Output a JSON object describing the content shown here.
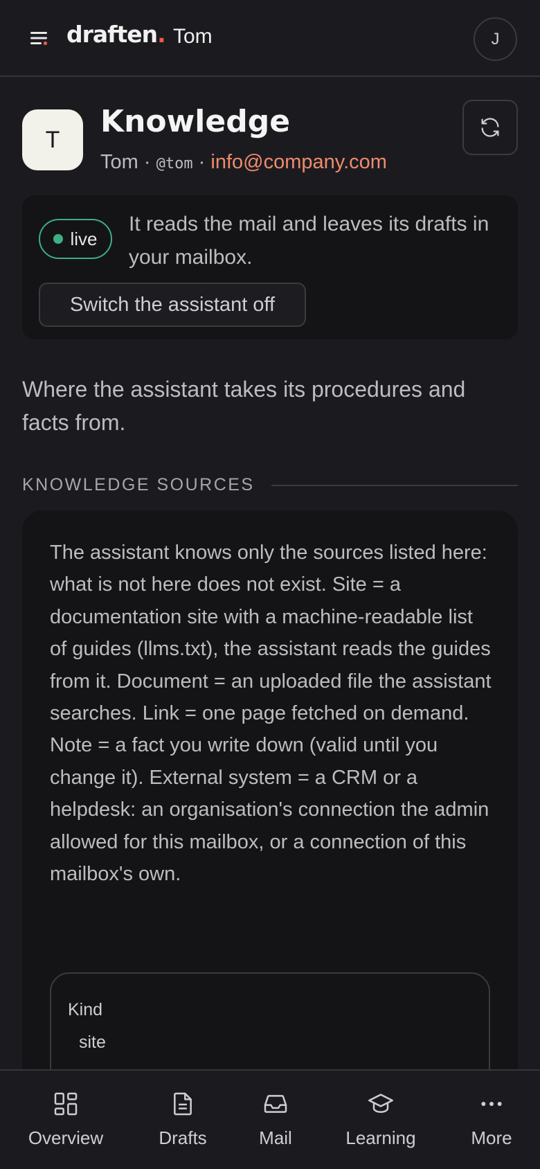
{
  "app": {
    "brand": "draften",
    "brand_dot": ".",
    "user_name": "Tom",
    "account_initial": "J"
  },
  "header": {
    "avatar_initial": "T",
    "title": "Knowledge",
    "mailbox_name": "Tom",
    "separator": "·",
    "handle": "@tom",
    "email": "info@company.com"
  },
  "status": {
    "badge": "live",
    "text": "It reads the mail and leaves its drafts in your mailbox.",
    "switch_label": "Switch the assistant off"
  },
  "intro": "Where the assistant takes its procedures and facts from.",
  "sources": {
    "heading": "KNOWLEDGE SOURCES",
    "description": "The assistant knows only the sources listed here: what is not here does not exist. Site = a documentation site with a machine-readable list of guides (llms.txt), the assistant reads the guides from it. Document = an uploaded file the assistant searches. Link = one page fetched on demand. Note = a fact you write down (valid until you change it). External system = a CRM or a helpdesk: an organisation's connection the admin allowed for this mailbox, or a connection of this mailbox's own.",
    "item": {
      "kind_label": "Kind",
      "kind_value": "site"
    }
  },
  "nav": {
    "items": [
      {
        "label": "Overview",
        "icon": "grid-icon"
      },
      {
        "label": "Drafts",
        "icon": "document-icon"
      },
      {
        "label": "Mail",
        "icon": "inbox-icon"
      },
      {
        "label": "Learning",
        "icon": "graduation-cap-icon"
      },
      {
        "label": "More",
        "icon": "more-dots-icon"
      }
    ]
  },
  "colors": {
    "background": "#1b1b1f",
    "card": "#141417",
    "accent_email": "#f08a6e",
    "live_green": "#3fae84",
    "brand_dot": "#ef5a47"
  }
}
